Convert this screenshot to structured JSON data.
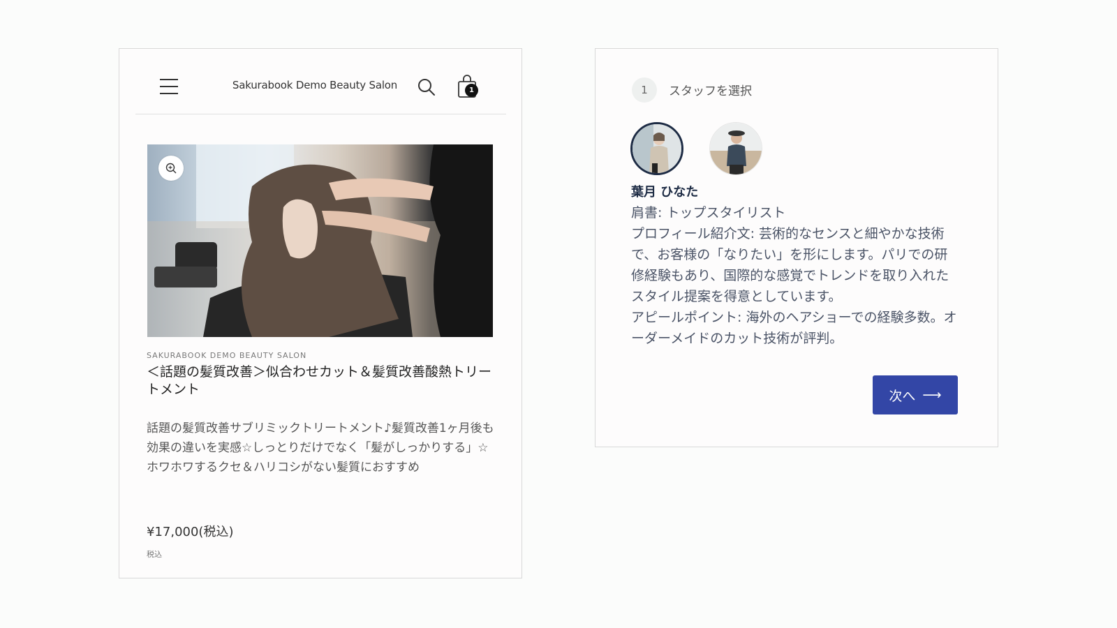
{
  "header": {
    "brand": "Sakurabook Demo Beauty Salon",
    "cart_count": "1"
  },
  "product": {
    "vendor": "SAKURABOOK DEMO BEAUTY SALON",
    "title": "＜話題の髪質改善＞似合わせカット＆髪質改善酸熱トリートメント",
    "description": "話題の髪質改善サブリミックトリートメント♪髪質改善1ヶ月後も効果の違いを実感☆しっとりだけでなく「髪がしっかりする」☆ホワホワするクセ＆ハリコシがない髪質におすすめ",
    "price": "¥17,000(税込)",
    "tax_note": "税込"
  },
  "booking": {
    "step_number": "1",
    "step_label": "スタッフを選択",
    "staff": {
      "name": "葉月 ひなた",
      "title": "肩書: トップスタイリスト",
      "profile": "プロフィール紹介文: 芸術的なセンスと細やかな技術で、お客様の「なりたい」を形にします。パリでの研修経験もあり、国際的な感覚でトレンドを取り入れたスタイル提案を得意としています。",
      "appeal": "アピールポイント: 海外のヘアショーでの経験多数。オーダーメイドのカット技術が評判。"
    },
    "next_label": "次へ",
    "next_arrow": "⟶"
  },
  "colors": {
    "accent": "#3346a6",
    "staff_name": "#1d2b44"
  }
}
